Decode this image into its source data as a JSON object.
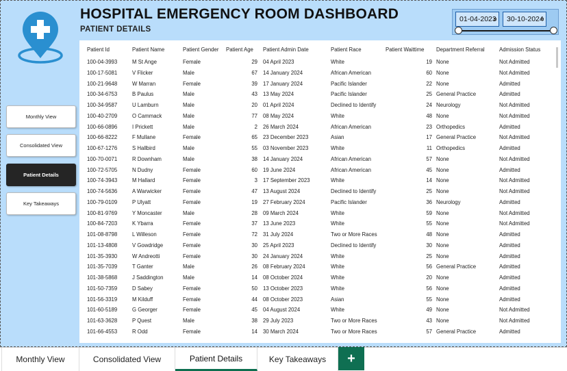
{
  "colors": {
    "canvas_bg": "#b9ddfb",
    "logo_blue": "#2a8fd0",
    "active_nav": "#252525",
    "active_tab_underline": "#0d6e4f",
    "add_tab_bg": "#0f6f52"
  },
  "header": {
    "title": "HOSPITAL EMERGENCY ROOM DASHBOARD",
    "subtitle": "PATIENT DETAILS",
    "logo_icon": "medical-location-pin-icon"
  },
  "date_slicer": {
    "start": "01-04-2023",
    "end": "30-10-2024"
  },
  "nav": {
    "monthly": "Monthly View",
    "consolidated": "Consolidated View",
    "patient": "Patient Details",
    "takeaways": "Key Takeaways"
  },
  "table": {
    "columns": [
      "Patient Id",
      "Patient Name",
      "Patient Gender",
      "Patient Age",
      "Patient Admin Date",
      "Patient Race",
      "Patient Waittime",
      "Department Referral",
      "Admission Status"
    ],
    "rows": [
      [
        "100-04-3993",
        "M St Ange",
        "Female",
        "29",
        "04 April 2023",
        "White",
        "19",
        "None",
        "Not Admitted"
      ],
      [
        "100-17-5081",
        "V Flicker",
        "Male",
        "67",
        "14 January 2024",
        "African American",
        "60",
        "None",
        "Not Admitted"
      ],
      [
        "100-21-9648",
        "W Marran",
        "Female",
        "39",
        "17 January 2024",
        "Pacific Islander",
        "22",
        "None",
        "Admitted"
      ],
      [
        "100-34-6753",
        "B Paulus",
        "Male",
        "43",
        "13 May 2024",
        "Pacific Islander",
        "25",
        "General Practice",
        "Admitted"
      ],
      [
        "100-34-9587",
        "U Lamburn",
        "Male",
        "20",
        "01 April 2024",
        "Declined to Identify",
        "24",
        "Neurology",
        "Not Admitted"
      ],
      [
        "100-40-2709",
        "O Cammack",
        "Male",
        "77",
        "08 May 2024",
        "White",
        "48",
        "None",
        "Not Admitted"
      ],
      [
        "100-66-0896",
        "I Prickett",
        "Male",
        "2",
        "26 March 2024",
        "African American",
        "23",
        "Orthopedics",
        "Admitted"
      ],
      [
        "100-66-8222",
        "F Mullane",
        "Female",
        "65",
        "23 December 2023",
        "Asian",
        "17",
        "General Practice",
        "Not Admitted"
      ],
      [
        "100-67-1276",
        "S Hallbird",
        "Male",
        "55",
        "03 November 2023",
        "White",
        "11",
        "Orthopedics",
        "Admitted"
      ],
      [
        "100-70-0071",
        "R Downham",
        "Male",
        "38",
        "14 January 2024",
        "African American",
        "57",
        "None",
        "Not Admitted"
      ],
      [
        "100-72-5705",
        "N Dudny",
        "Female",
        "60",
        "19 June 2024",
        "African American",
        "45",
        "None",
        "Admitted"
      ],
      [
        "100-74-3943",
        "M Hallard",
        "Female",
        "3",
        "17 September 2023",
        "White",
        "14",
        "None",
        "Not Admitted"
      ],
      [
        "100-74-5636",
        "A Warwicker",
        "Female",
        "47",
        "13 August 2024",
        "Declined to Identify",
        "25",
        "None",
        "Not Admitted"
      ],
      [
        "100-79-0109",
        "P Ulyatt",
        "Female",
        "19",
        "27 February 2024",
        "Pacific Islander",
        "36",
        "Neurology",
        "Admitted"
      ],
      [
        "100-81-9769",
        "Y Moncaster",
        "Male",
        "28",
        "09 March 2024",
        "White",
        "59",
        "None",
        "Not Admitted"
      ],
      [
        "100-84-7203",
        "K Ybarra",
        "Female",
        "37",
        "13 June 2023",
        "White",
        "55",
        "None",
        "Not Admitted"
      ],
      [
        "101-08-8798",
        "L Willeson",
        "Female",
        "72",
        "31 July 2024",
        "Two or More Races",
        "48",
        "None",
        "Admitted"
      ],
      [
        "101-13-4808",
        "V Gowdridge",
        "Female",
        "30",
        "25 April 2023",
        "Declined to Identify",
        "30",
        "None",
        "Admitted"
      ],
      [
        "101-35-3930",
        "W Andreotti",
        "Female",
        "30",
        "24 January 2024",
        "White",
        "25",
        "None",
        "Admitted"
      ],
      [
        "101-35-7039",
        "T Ganter",
        "Male",
        "26",
        "08 February 2024",
        "White",
        "56",
        "General Practice",
        "Admitted"
      ],
      [
        "101-38-5868",
        "J Saddington",
        "Male",
        "14",
        "08 October 2024",
        "White",
        "20",
        "None",
        "Admitted"
      ],
      [
        "101-50-7359",
        "D Sabey",
        "Female",
        "50",
        "13 October 2023",
        "White",
        "56",
        "None",
        "Admitted"
      ],
      [
        "101-56-3319",
        "M Kilduff",
        "Female",
        "44",
        "08 October 2023",
        "Asian",
        "55",
        "None",
        "Admitted"
      ],
      [
        "101-60-5189",
        "G Georger",
        "Female",
        "45",
        "04 August 2024",
        "White",
        "49",
        "None",
        "Not Admitted"
      ],
      [
        "101-63-3628",
        "P Quest",
        "Male",
        "38",
        "29 July 2023",
        "Two or More Races",
        "43",
        "None",
        "Not Admitted"
      ],
      [
        "101-66-4553",
        "R Odd",
        "Female",
        "14",
        "30 March 2024",
        "Two or More Races",
        "57",
        "General Practice",
        "Admitted"
      ]
    ]
  },
  "tabs": {
    "monthly": "Monthly View",
    "consolidated": "Consolidated View",
    "patient": "Patient Details",
    "takeaways": "Key Takeaways",
    "add": "+"
  }
}
